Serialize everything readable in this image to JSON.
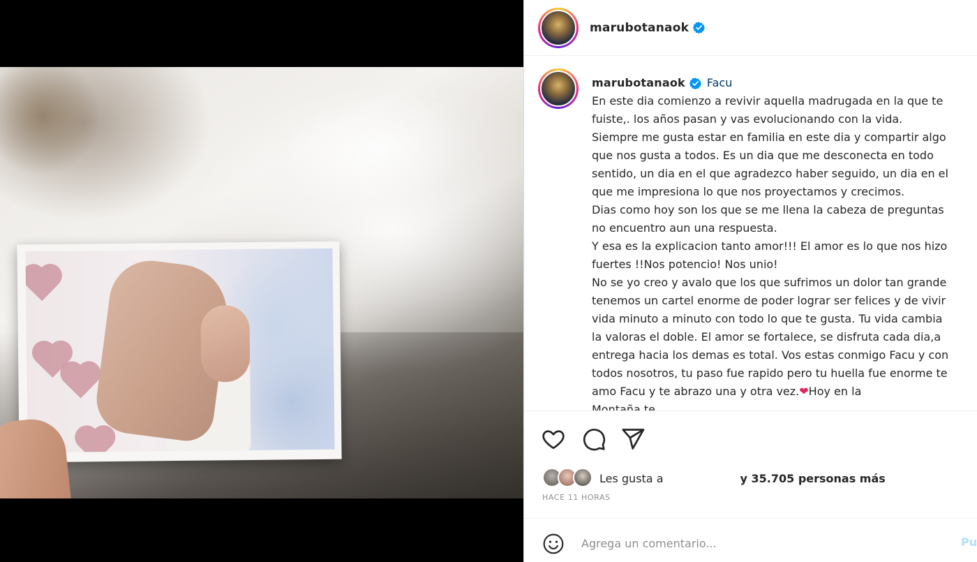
{
  "post": {
    "username": "marubotanaok",
    "verified_icon": "verified-badge-icon",
    "caption_tag": "Facu",
    "caption_lines": [
      "En este dia comienzo a revivir aquella madrugada en la que te",
      "fuiste,. los años pasan y vas evolucionando con la vida.",
      "Siempre me gusta estar en familia en este dia y compartir algo",
      "que nos gusta a todos. Es un dia que me desconecta en todo",
      "sentido, un dia en el que agradezco haber seguido, un dia en el",
      "que me impresiona lo que nos proyectamos y crecimos.",
      "Dias como hoy son los que se me llena la cabeza de preguntas",
      "no encuentro aun una respuesta.",
      "Y esa es la explicacion tanto amor!!! El amor es lo que nos hizo",
      "fuertes !!Nos potencio! Nos unio!",
      "No se yo creo y avalo que los que sufrimos un dolor tan grande",
      "tenemos un cartel enorme de poder lograr ser felices y de vivir",
      "vida minuto a minuto con todo lo que te gusta. Tu vida cambia",
      "la valoras el doble. El amor se fortalece, se disfruta cada dia,a",
      "entrega hacia los demas es total. Vos estas conmigo Facu y con",
      "todos nosotros, tu paso fue rapido pero tu huella fue enorme te",
      "amo Facu y te abrazo una y otra vez.",
      "Montaña te ..."
    ],
    "heart_emoji": "❤",
    "caption_after_heart": "Hoy en la",
    "likes_prefix": "Les gusta a",
    "likes_suffix": "y 35.705 personas más",
    "timestamp": "HACE 11 HORAS",
    "comment_placeholder": "Agrega un comentario...",
    "post_button": "Pu",
    "icons": {
      "like": "heart-outline-icon",
      "comment": "comment-bubble-icon",
      "share": "paper-plane-icon",
      "emoji": "smiley-icon"
    },
    "colors": {
      "text": "#262626",
      "secondary": "#8e8e8e",
      "verified": "#0095f6",
      "post_button": "#b2dffc",
      "heart": "#e0245e"
    }
  }
}
